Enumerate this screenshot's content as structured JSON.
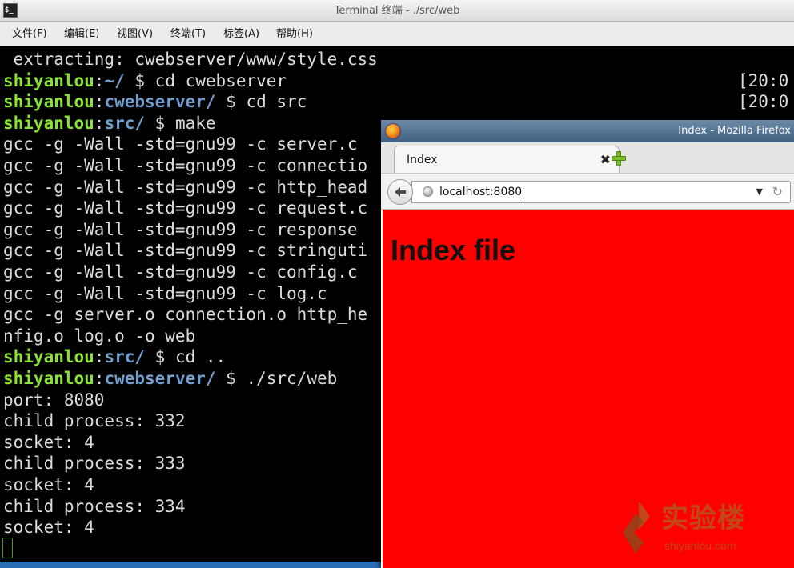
{
  "terminal": {
    "title": "Terminal 终端 - ./src/web",
    "icon": "terminal-icon",
    "menu": [
      {
        "label": "文件(F)"
      },
      {
        "label": "编辑(E)"
      },
      {
        "label": "视图(V)"
      },
      {
        "label": "终端(T)"
      },
      {
        "label": "标签(A)"
      },
      {
        "label": "帮助(H)"
      }
    ],
    "lines": [
      {
        "plain": " extracting: cwebserver/www/style.css"
      },
      {
        "user": "shiyanlou",
        "colon": ":",
        "path": "~/",
        "cmd": " $ cd cwebserver"
      },
      {
        "user": "shiyanlou",
        "colon": ":",
        "path": "cwebserver/",
        "cmd": " $ cd src"
      },
      {
        "user": "shiyanlou",
        "colon": ":",
        "path": "src/",
        "cmd": " $ make"
      },
      {
        "plain": "gcc -g -Wall -std=gnu99 -c server.c"
      },
      {
        "plain": "gcc -g -Wall -std=gnu99 -c connectio"
      },
      {
        "plain": "gcc -g -Wall -std=gnu99 -c http_head"
      },
      {
        "plain": "gcc -g -Wall -std=gnu99 -c request.c"
      },
      {
        "plain": "gcc -g -Wall -std=gnu99 -c response"
      },
      {
        "plain": "gcc -g -Wall -std=gnu99 -c stringuti"
      },
      {
        "plain": "gcc -g -Wall -std=gnu99 -c config.c"
      },
      {
        "plain": "gcc -g -Wall -std=gnu99 -c log.c"
      },
      {
        "plain": "gcc -g server.o connection.o http_he"
      },
      {
        "plain": "nfig.o log.o -o web"
      },
      {
        "user": "shiyanlou",
        "colon": ":",
        "path": "src/",
        "cmd": " $ cd .."
      },
      {
        "user": "shiyanlou",
        "colon": ":",
        "path": "cwebserver/",
        "cmd": " $ ./src/web"
      },
      {
        "plain": "port: 8080"
      },
      {
        "plain": "child process: 332"
      },
      {
        "plain": "socket: 4"
      },
      {
        "plain": "child process: 333"
      },
      {
        "plain": "socket: 4"
      },
      {
        "plain": "child process: 334"
      },
      {
        "plain": "socket: 4"
      }
    ],
    "timestamps": [
      "[20:0",
      "[20:0"
    ]
  },
  "firefox": {
    "title": "Index - Mozilla Firefox",
    "tab_label": "Index",
    "tab_close": "✖",
    "url": "localhost:8080",
    "dropdown_glyph": "▼",
    "reload_glyph": "↻",
    "back_glyph": "🡐",
    "page_heading": "Index file",
    "page_background": "#ff0000"
  },
  "watermark": {
    "text": "实验楼",
    "domain": "shiyanlou.com",
    "color": "#b35a1f"
  }
}
